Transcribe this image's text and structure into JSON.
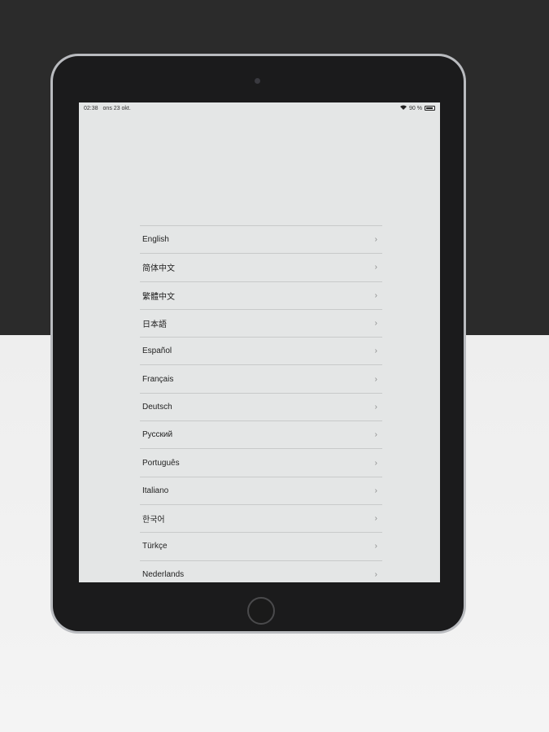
{
  "status_bar": {
    "time": "02:38",
    "date": "ons 23 okt.",
    "battery": "90 %",
    "battery_level": 0.9,
    "wifi_icon": "wifi-icon"
  },
  "languages": [
    {
      "label": "English"
    },
    {
      "label": "简体中文"
    },
    {
      "label": "繁體中文"
    },
    {
      "label": "日本語"
    },
    {
      "label": "Español"
    },
    {
      "label": "Français"
    },
    {
      "label": "Deutsch"
    },
    {
      "label": "Русский"
    },
    {
      "label": "Português"
    },
    {
      "label": "Italiano"
    },
    {
      "label": "한국어"
    },
    {
      "label": "Türkçe"
    },
    {
      "label": "Nederlands"
    }
  ],
  "chevron": "›"
}
